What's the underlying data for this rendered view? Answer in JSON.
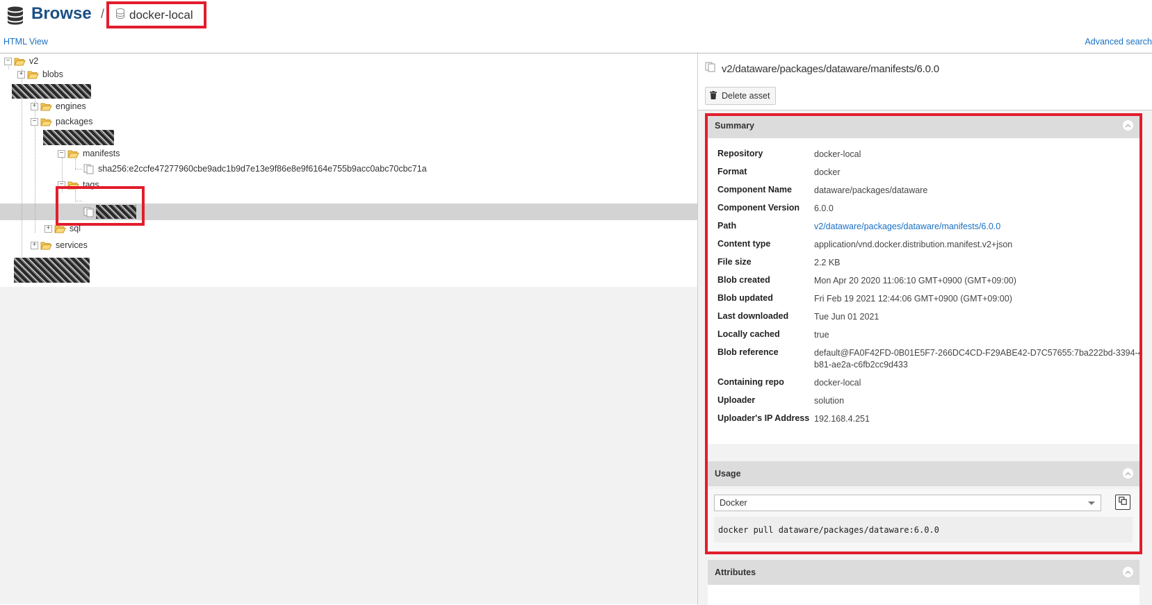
{
  "header": {
    "title": "Browse",
    "separator": "/",
    "repository": "docker-local",
    "html_view": "HTML View",
    "advanced_search": "Advanced search"
  },
  "tree": {
    "root": "v2",
    "items": {
      "blobs": "blobs",
      "engines": "engines",
      "packages": "packages",
      "manifests": "manifests",
      "manifest_file": "sha256:e2ccfe47277960cbe9adc1b9d7e13e9f86e8e9f6164e755b9acc0abc70cbc71a",
      "tags": "tags",
      "sql": "sql",
      "services": "services"
    }
  },
  "asset": {
    "path": "v2/dataware/packages/dataware/manifests/6.0.0",
    "delete_label": "Delete asset"
  },
  "summary": {
    "title": "Summary",
    "rows": [
      {
        "key": "Repository",
        "value": "docker-local"
      },
      {
        "key": "Format",
        "value": "docker"
      },
      {
        "key": "Component Name",
        "value": "dataware/packages/dataware"
      },
      {
        "key": "Component Version",
        "value": "6.0.0"
      },
      {
        "key": "Path",
        "value": "v2/dataware/packages/dataware/manifests/6.0.0"
      },
      {
        "key": "Content type",
        "value": "application/vnd.docker.distribution.manifest.v2+json"
      },
      {
        "key": "File size",
        "value": "2.2 KB"
      },
      {
        "key": "Blob created",
        "value": "Mon Apr 20 2020 11:06:10 GMT+0900 (GMT+09:00)"
      },
      {
        "key": "Blob updated",
        "value": "Fri Feb 19 2021 12:44:06 GMT+0900 (GMT+09:00)"
      },
      {
        "key": "Last downloaded",
        "value": "Tue Jun 01 2021"
      },
      {
        "key": "Locally cached",
        "value": "true"
      },
      {
        "key": "Blob reference",
        "value": "default@FA0F42FD-0B01E5F7-266DC4CD-F29ABE42-D7C57655:7ba222bd-3394-4b81-ae2a-c6fb2cc9d433"
      },
      {
        "key": "Containing repo",
        "value": "docker-local"
      },
      {
        "key": "Uploader",
        "value": "solution"
      },
      {
        "key": "Uploader's IP Address",
        "value": "192.168.4.251"
      }
    ]
  },
  "usage": {
    "title": "Usage",
    "format_selected": "Docker",
    "command": "docker pull dataware/packages/dataware:6.0.0"
  },
  "attributes": {
    "title": "Attributes"
  },
  "colors": {
    "highlight_red": "#e21d2c",
    "title_blue": "#1b4f85",
    "link_blue": "#1a6fc4",
    "folder_yellow": "#f6c453"
  }
}
